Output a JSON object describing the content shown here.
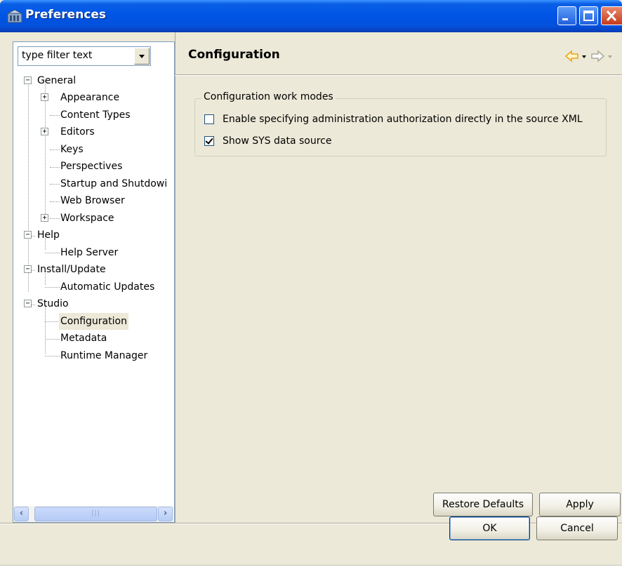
{
  "window": {
    "title": "Preferences"
  },
  "filter": {
    "value": "type filter text"
  },
  "tree": [
    {
      "label": "General",
      "expanded": true
    },
    {
      "label": "Appearance",
      "expanded": false
    },
    {
      "label": "Content Types"
    },
    {
      "label": "Editors",
      "expanded": false
    },
    {
      "label": "Keys"
    },
    {
      "label": "Perspectives"
    },
    {
      "label": "Startup and Shutdowi"
    },
    {
      "label": "Web Browser"
    },
    {
      "label": "Workspace",
      "expanded": false
    },
    {
      "label": "Help",
      "expanded": true
    },
    {
      "label": "Help Server"
    },
    {
      "label": "Install/Update",
      "expanded": true
    },
    {
      "label": "Automatic Updates"
    },
    {
      "label": "Studio",
      "expanded": true
    },
    {
      "label": "Configuration",
      "selected": true
    },
    {
      "label": "Metadata"
    },
    {
      "label": "Runtime Manager"
    }
  ],
  "page": {
    "title": "Configuration",
    "group_title": "Configuration work modes",
    "options": [
      {
        "label": "Enable specifying administration authorization directly in the source XML",
        "checked": false
      },
      {
        "label": "Show SYS data source",
        "checked": true
      }
    ]
  },
  "buttons": {
    "restore_defaults": "Restore Defaults",
    "apply": "Apply",
    "ok": "OK",
    "cancel": "Cancel"
  },
  "colors": {
    "titlebar": "#0055e5",
    "window_bg": "#ece9d8",
    "back_arrow": "#e8a317",
    "forward_arrow": "#aca899"
  }
}
